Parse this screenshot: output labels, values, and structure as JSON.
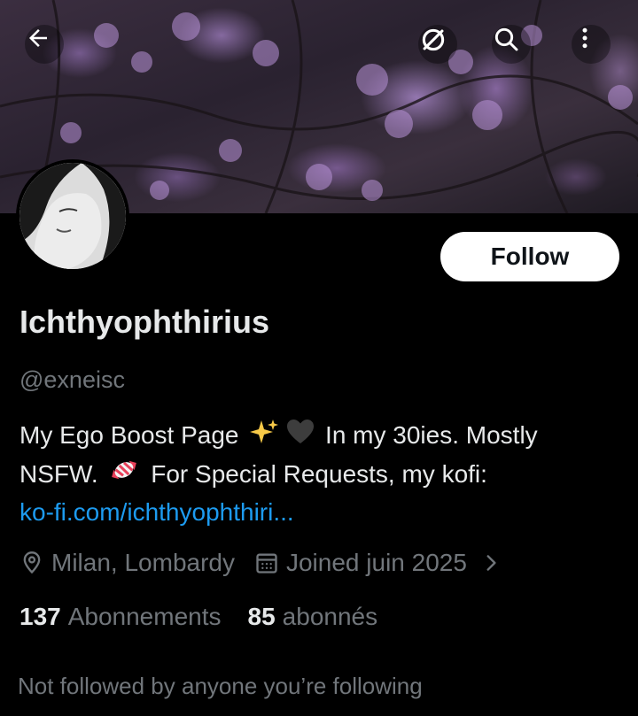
{
  "header": {
    "back_icon": "arrow-left-icon",
    "grok_icon": "grok-icon",
    "search_icon": "search-icon",
    "more_icon": "more-vertical-icon"
  },
  "profile": {
    "display_name": "Ichthyophthirius",
    "handle": "@exneisc",
    "follow_label": "Follow",
    "bio": {
      "line1_a": "My Ego Boost Page",
      "line1_b": "In my 30ies. Mostly",
      "line2_a": "NSFW.",
      "line2_b": "For Special Requests, my kofi:",
      "link": "ko-fi.com/ichthyophthiri..."
    },
    "location": "Milan, Lombardy",
    "joined": "Joined juin 2025",
    "following_count": "137",
    "following_label": "Abonnements",
    "followers_count": "85",
    "followers_label": "abonnés",
    "followed_by": "Not followed by anyone you’re following"
  },
  "colors": {
    "background": "#000000",
    "text": "#e7e9ea",
    "muted": "#71767b",
    "link": "#1d9bf0",
    "follow_button_bg": "#ffffff"
  }
}
